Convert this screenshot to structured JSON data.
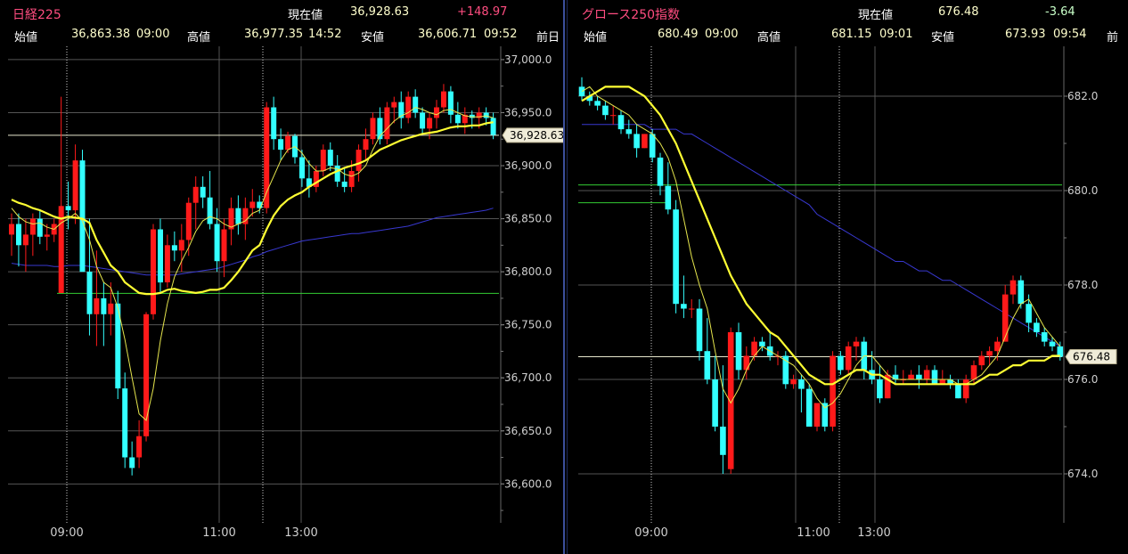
{
  "colors": {
    "up": "#ff1a1a",
    "down": "#33ffff",
    "ma_fast": "#ffff33",
    "ma_mid": "#e6e64d",
    "ma_slow": "#3838d0",
    "grid": "#555555",
    "prev_close_line": "#33cc33",
    "current_line": "#e6e6cc",
    "divider": "#3c4f9c"
  },
  "panels": [
    {
      "title": "日経225",
      "current_label": "現在値",
      "current": "36,928.63",
      "change": "+148.97",
      "open_label": "始値",
      "open": "36,863.38",
      "open_time": "09:00",
      "high_label": "高値",
      "high": "36,977.35",
      "high_time": "14:52",
      "low_label": "安値",
      "low": "36,606.71",
      "low_time": "09:52",
      "prev_label": "前日",
      "current_tag": "36,928.63"
    },
    {
      "title": "グロース250指数",
      "current_label": "現在値",
      "current": "676.48",
      "change": "-3.64",
      "open_label": "始値",
      "open": "680.49",
      "open_time": "09:00",
      "high_label": "高値",
      "high": "681.15",
      "high_time": "09:01",
      "low_label": "安値",
      "low": "673.93",
      "low_time": "09:54",
      "prev_label": "前",
      "current_tag": "676.48"
    }
  ],
  "chart_data": [
    {
      "type": "candlestick",
      "name": "日経225",
      "ylim": [
        36565,
        37010
      ],
      "yticks": [
        "37,000.0",
        "36,950.0",
        "36,900.0",
        "36,850.0",
        "36,800.0",
        "36,750.0",
        "36,700.0",
        "36,650.0",
        "36,600.0"
      ],
      "ytick_values": [
        37000,
        36950,
        36900,
        36850,
        36800,
        36750,
        36700,
        36650,
        36600
      ],
      "xticks": [
        "09:00",
        "11:00",
        "13:00"
      ],
      "prev_close": 36779.66,
      "current": 36928.63,
      "candles": [
        [
          36835,
          36855,
          36815,
          36845
        ],
        [
          36845,
          36855,
          36805,
          36825
        ],
        [
          36825,
          36850,
          36800,
          36835
        ],
        [
          36835,
          36855,
          36815,
          36850
        ],
        [
          36850,
          36858,
          36826,
          36833
        ],
        [
          36833,
          36845,
          36820,
          36835
        ],
        [
          36835,
          36850,
          36828,
          36845
        ],
        [
          36780,
          36965,
          36780,
          36862
        ],
        [
          36862,
          36885,
          36840,
          36858
        ],
        [
          36858,
          36920,
          36845,
          36905
        ],
        [
          36905,
          36915,
          36870,
          36800
        ],
        [
          36800,
          36850,
          36740,
          36760
        ],
        [
          36760,
          36820,
          36730,
          36775
        ],
        [
          36775,
          36790,
          36730,
          36760
        ],
        [
          36760,
          36790,
          36740,
          36770
        ],
        [
          36770,
          36782,
          36680,
          36690
        ],
        [
          36690,
          36705,
          36615,
          36625
        ],
        [
          36625,
          36640,
          36608,
          36615
        ],
        [
          36625,
          36660,
          36615,
          36645
        ],
        [
          36645,
          36762,
          36640,
          36760
        ],
        [
          36760,
          36845,
          36755,
          36840
        ],
        [
          36840,
          36850,
          36780,
          36790
        ],
        [
          36790,
          36835,
          36785,
          36825
        ],
        [
          36825,
          36838,
          36810,
          36820
        ],
        [
          36820,
          36845,
          36800,
          36830
        ],
        [
          36830,
          36870,
          36815,
          36865
        ],
        [
          36865,
          36890,
          36840,
          36880
        ],
        [
          36880,
          36890,
          36860,
          36870
        ],
        [
          36870,
          36895,
          36840,
          36845
        ],
        [
          36845,
          36860,
          36800,
          36810
        ],
        [
          36810,
          36850,
          36795,
          36840
        ],
        [
          36840,
          36870,
          36825,
          36860
        ],
        [
          36860,
          36872,
          36835,
          36845
        ],
        [
          36845,
          36870,
          36830,
          36860
        ],
        [
          36860,
          36878,
          36852,
          36866
        ],
        [
          36866,
          36872,
          36855,
          36860
        ],
        [
          36860,
          36960,
          36855,
          36955
        ],
        [
          36955,
          36965,
          36915,
          36925
        ],
        [
          36925,
          36935,
          36905,
          36915
        ],
        [
          36915,
          36932,
          36912,
          36928
        ],
        [
          36928,
          36930,
          36902,
          36908
        ],
        [
          36908,
          36915,
          36880,
          36888
        ],
        [
          36888,
          36905,
          36870,
          36880
        ],
        [
          36880,
          36900,
          36875,
          36895
        ],
        [
          36895,
          36920,
          36890,
          36915
        ],
        [
          36915,
          36922,
          36895,
          36900
        ],
        [
          36900,
          36910,
          36880,
          36885
        ],
        [
          36885,
          36898,
          36875,
          36880
        ],
        [
          36880,
          36905,
          36875,
          36895
        ],
        [
          36895,
          36920,
          36885,
          36915
        ],
        [
          36915,
          36935,
          36905,
          36925
        ],
        [
          36925,
          36950,
          36920,
          36945
        ],
        [
          36945,
          36955,
          36920,
          36925
        ],
        [
          36925,
          36960,
          36920,
          36955
        ],
        [
          36955,
          36965,
          36940,
          36960
        ],
        [
          36960,
          36970,
          36935,
          36945
        ],
        [
          36945,
          36970,
          36940,
          36965
        ],
        [
          36965,
          36972,
          36945,
          36950
        ],
        [
          36950,
          36955,
          36930,
          36935
        ],
        [
          36935,
          36950,
          36925,
          36945
        ],
        [
          36945,
          36962,
          36935,
          36955
        ],
        [
          36955,
          36977,
          36950,
          36970
        ],
        [
          36970,
          36975,
          36940,
          36948
        ],
        [
          36948,
          36960,
          36935,
          36940
        ],
        [
          36940,
          36955,
          36930,
          36948
        ],
        [
          36948,
          36952,
          36935,
          36945
        ],
        [
          36945,
          36955,
          36935,
          36950
        ],
        [
          36950,
          36955,
          36938,
          36945
        ],
        [
          36945,
          36950,
          36925,
          36929
        ]
      ],
      "ma_fast": [
        36860,
        36852,
        36847,
        36845,
        36846,
        36842,
        36840,
        36846,
        36850,
        36855,
        36848,
        36830,
        36805,
        36790,
        36785,
        36766,
        36736,
        36700,
        36666,
        36660,
        36690,
        36735,
        36770,
        36795,
        36810,
        36823,
        36838,
        36848,
        36852,
        36850,
        36845,
        36842,
        36845,
        36848,
        36855,
        36858,
        36875,
        36890,
        36905,
        36915,
        36918,
        36912,
        36902,
        36895,
        36895,
        36898,
        36897,
        36892,
        36890,
        36893,
        36900,
        36915,
        36928,
        36935,
        36942,
        36947,
        36950,
        36955,
        36953,
        36950,
        36948,
        36952,
        36953,
        36950,
        36947,
        36946,
        36946,
        36947,
        36945
      ],
      "ma_mid": [
        36868,
        36865,
        36863,
        36860,
        36858,
        36855,
        36852,
        36850,
        36852,
        36851,
        36850,
        36846,
        36830,
        36818,
        36806,
        36800,
        36790,
        36785,
        36780,
        36779,
        36779,
        36780,
        36783,
        36784,
        36782,
        36781,
        36780,
        36781,
        36783,
        36783,
        36785,
        36792,
        36800,
        36810,
        36820,
        36825,
        36840,
        36853,
        36862,
        36868,
        36872,
        36875,
        36880,
        36884,
        36888,
        36892,
        36895,
        36898,
        36900,
        36902,
        36905,
        36910,
        36915,
        36918,
        36921,
        36924,
        36926,
        36928,
        36930,
        36931,
        36932,
        36934,
        36936,
        36937,
        36937,
        36938,
        36938,
        36940,
        36941
      ],
      "ma_slow": [
        36808,
        36807,
        36806,
        36806,
        36806,
        36806,
        36805,
        36805,
        36806,
        36806,
        36806,
        36805,
        36804,
        36803,
        36802,
        36801,
        36800,
        36799,
        36798,
        36797,
        36797,
        36797,
        36797,
        36797,
        36798,
        36799,
        36800,
        36801,
        36802,
        36803,
        36805,
        36807,
        36809,
        36811,
        36814,
        36816,
        36819,
        36821,
        36823,
        36825,
        36827,
        36829,
        36830,
        36831,
        36832,
        36833,
        36834,
        36835,
        36836,
        36836,
        36837,
        36838,
        36839,
        36840,
        36841,
        36842,
        36843,
        36845,
        36847,
        36849,
        36851,
        36852,
        36853,
        36854,
        36855,
        36856,
        36857,
        36858,
        36860
      ]
    },
    {
      "type": "candlestick",
      "name": "グロース250指数",
      "ylim": [
        673.0,
        683.0
      ],
      "yticks": [
        "682.0",
        "680.0",
        "678.0",
        "676.0",
        "674.0"
      ],
      "ytick_values": [
        682,
        680,
        678,
        676,
        674
      ],
      "xticks": [
        "09:00",
        "11:00",
        "13:00"
      ],
      "prev_close": 680.12,
      "current": 676.48,
      "candles": [
        [
          682.2,
          682.4,
          681.9,
          682.0
        ],
        [
          682.0,
          682.1,
          681.8,
          681.9
        ],
        [
          681.9,
          682.0,
          681.7,
          681.8
        ],
        [
          681.8,
          681.9,
          681.5,
          681.6
        ],
        [
          681.6,
          681.8,
          681.4,
          681.6
        ],
        [
          681.6,
          681.7,
          681.2,
          681.3
        ],
        [
          681.3,
          681.5,
          681.1,
          681.2
        ],
        [
          681.2,
          681.4,
          680.7,
          680.9
        ],
        [
          680.9,
          681.2,
          680.9,
          681.2
        ],
        [
          681.2,
          681.3,
          680.6,
          680.7
        ],
        [
          680.7,
          680.8,
          679.9,
          680.1
        ],
        [
          680.1,
          680.6,
          679.5,
          679.6
        ],
        [
          679.6,
          679.8,
          677.4,
          677.6
        ],
        [
          677.6,
          678.2,
          677.3,
          677.5
        ],
        [
          677.5,
          677.7,
          677.3,
          677.5
        ],
        [
          677.5,
          677.7,
          676.4,
          676.6
        ],
        [
          676.6,
          677.3,
          675.9,
          676.0
        ],
        [
          676.0,
          676.5,
          674.9,
          675.0
        ],
        [
          675.0,
          676.3,
          674.0,
          674.4
        ],
        [
          674.1,
          677.1,
          674.0,
          677.0
        ],
        [
          677.0,
          677.2,
          676.0,
          676.2
        ],
        [
          676.2,
          676.7,
          676.0,
          676.5
        ],
        [
          676.5,
          676.9,
          676.4,
          676.8
        ],
        [
          676.8,
          676.9,
          676.6,
          676.7
        ],
        [
          676.7,
          677.0,
          676.4,
          676.5
        ],
        [
          676.5,
          676.6,
          676.3,
          676.5
        ],
        [
          676.5,
          676.6,
          675.8,
          675.9
        ],
        [
          675.9,
          676.1,
          675.8,
          676.0
        ],
        [
          676.0,
          676.1,
          675.3,
          675.8
        ],
        [
          675.8,
          675.9,
          675.0,
          675.0
        ],
        [
          675.0,
          675.5,
          674.9,
          675.5
        ],
        [
          675.5,
          675.6,
          674.9,
          675.0
        ],
        [
          675.0,
          676.6,
          674.9,
          676.5
        ],
        [
          676.5,
          676.6,
          676.1,
          676.2
        ],
        [
          676.2,
          676.8,
          676.1,
          676.7
        ],
        [
          676.7,
          676.9,
          676.4,
          676.8
        ],
        [
          676.8,
          676.9,
          676.0,
          676.2
        ],
        [
          676.2,
          676.6,
          675.9,
          676.0
        ],
        [
          676.0,
          676.3,
          675.5,
          675.6
        ],
        [
          675.6,
          676.2,
          675.6,
          676.1
        ],
        [
          676.1,
          676.3,
          675.9,
          676.0
        ],
        [
          676.0,
          676.2,
          675.9,
          676.0
        ],
        [
          676.0,
          676.2,
          676.0,
          676.1
        ],
        [
          676.1,
          676.3,
          675.8,
          676.0
        ],
        [
          676.0,
          676.3,
          675.9,
          676.2
        ],
        [
          676.2,
          676.3,
          675.9,
          675.9
        ],
        [
          675.9,
          676.2,
          675.9,
          676.0
        ],
        [
          676.0,
          676.1,
          675.8,
          675.9
        ],
        [
          675.9,
          676.0,
          675.6,
          675.6
        ],
        [
          675.6,
          676.1,
          675.5,
          676.0
        ],
        [
          676.0,
          676.4,
          675.9,
          676.3
        ],
        [
          676.3,
          676.6,
          676.2,
          676.5
        ],
        [
          676.5,
          676.7,
          676.3,
          676.6
        ],
        [
          676.6,
          676.9,
          676.4,
          676.8
        ],
        [
          676.8,
          678.0,
          676.8,
          677.8
        ],
        [
          677.8,
          678.2,
          677.6,
          678.1
        ],
        [
          678.1,
          678.2,
          677.5,
          677.6
        ],
        [
          677.6,
          677.8,
          677.0,
          677.2
        ],
        [
          677.2,
          677.3,
          676.9,
          677.0
        ],
        [
          677.0,
          677.1,
          676.7,
          676.8
        ],
        [
          676.8,
          676.9,
          676.6,
          676.7
        ],
        [
          676.7,
          676.8,
          676.4,
          676.48
        ]
      ],
      "ma_fast": [
        682.1,
        682.2,
        682.0,
        681.9,
        681.8,
        681.7,
        681.6,
        681.4,
        681.3,
        681.2,
        681.0,
        680.7,
        680.2,
        679.4,
        678.6,
        678.0,
        677.5,
        676.6,
        675.8,
        675.5,
        675.8,
        676.2,
        676.5,
        676.7,
        676.6,
        676.5,
        676.4,
        676.3,
        676.1,
        675.9,
        675.6,
        675.4,
        675.5,
        675.7,
        676.0,
        676.3,
        676.5,
        676.5,
        676.3,
        676.1,
        676.0,
        676.0,
        676.0,
        676.0,
        676.0,
        676.0,
        676.0,
        676.0,
        675.9,
        675.9,
        676.0,
        676.1,
        676.3,
        676.5,
        676.9,
        677.3,
        677.6,
        677.7,
        677.4,
        677.1,
        676.9,
        676.7
      ],
      "ma_mid": [
        681.9,
        682.0,
        682.1,
        682.2,
        682.2,
        682.2,
        682.2,
        682.1,
        682.0,
        681.8,
        681.6,
        681.3,
        681.0,
        680.6,
        680.2,
        679.8,
        679.4,
        679.0,
        678.6,
        678.2,
        677.9,
        677.6,
        677.4,
        677.2,
        677.0,
        676.9,
        676.7,
        676.5,
        676.3,
        676.1,
        676.0,
        675.9,
        675.9,
        676.0,
        676.1,
        676.2,
        676.2,
        676.1,
        676.1,
        676.0,
        675.9,
        675.9,
        675.9,
        675.9,
        675.9,
        675.9,
        675.9,
        675.9,
        675.9,
        675.9,
        675.9,
        676.0,
        676.1,
        676.1,
        676.2,
        676.3,
        676.3,
        676.4,
        676.4,
        676.4,
        676.5,
        676.5
      ],
      "ma_slow": [
        681.4,
        681.4,
        681.4,
        681.4,
        681.4,
        681.4,
        681.4,
        681.4,
        681.4,
        681.3,
        681.3,
        681.3,
        681.3,
        681.2,
        681.2,
        681.1,
        681.0,
        680.9,
        680.8,
        680.7,
        680.6,
        680.5,
        680.4,
        680.3,
        680.2,
        680.1,
        680.0,
        679.9,
        679.8,
        679.7,
        679.5,
        679.4,
        679.3,
        679.2,
        679.1,
        679.0,
        678.9,
        678.8,
        678.7,
        678.6,
        678.5,
        678.5,
        678.4,
        678.3,
        678.3,
        678.2,
        678.1,
        678.1,
        678.0,
        677.9,
        677.8,
        677.7,
        677.6,
        677.5,
        677.4,
        677.3,
        677.2,
        677.1,
        677.0,
        676.9,
        676.8,
        676.7
      ]
    }
  ]
}
